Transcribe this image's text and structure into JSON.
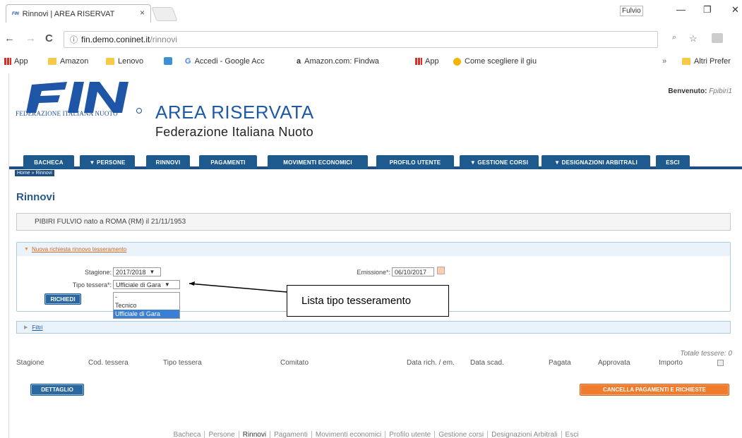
{
  "browser": {
    "tab_title": "Rinnovi | AREA RISERVAT",
    "tab_favicon_text": "FIN",
    "tab_close": "×",
    "window_user": "Fulvio",
    "win_min": "—",
    "win_max": "❐",
    "win_close": "✕",
    "back_icon": "←",
    "forward_icon": "→",
    "reload_icon": "C",
    "url_info_icon": "ⓘ",
    "url_host": "fin.demo.coninet.it",
    "url_path": "/rinnovi",
    "zoom_icon": "🔍",
    "star_icon": "☆",
    "bookmarks": [
      {
        "label": "App",
        "kind": "apps"
      },
      {
        "label": "Amazon",
        "kind": "folder"
      },
      {
        "label": "Lenovo",
        "kind": "folder"
      },
      {
        "label": "",
        "kind": "bing"
      },
      {
        "label": "Accedi - Google Acc",
        "kind": "google"
      },
      {
        "label": "Amazon.com: Findwa",
        "kind": "amazon"
      },
      {
        "label": "App",
        "kind": "apps"
      },
      {
        "label": "Come scegliere il giu",
        "kind": "tip"
      }
    ],
    "bookmarks_more": "»",
    "other_bookmarks": "Altri Prefer"
  },
  "header": {
    "logo_text": "FIN",
    "logo_sub": "FEDERAZIONE ITALIANA NUOTO",
    "title": "AREA RISERVATA",
    "subtitle": "Federazione Italiana Nuoto",
    "welcome_label": "Benvenuto:",
    "welcome_user": "Fpibiri1"
  },
  "menu": [
    {
      "label": "BACHECA"
    },
    {
      "label": "▼ PERSONE"
    },
    {
      "label": "RINNOVI"
    },
    {
      "label": "PAGAMENTI"
    },
    {
      "label": "MOVIMENTI ECONOMICI"
    },
    {
      "label": "PROFILO UTENTE"
    },
    {
      "label": "▼ GESTIONE CORSI"
    },
    {
      "label": "▼ DESIGNAZIONI ARBITRALI"
    },
    {
      "label": "ESCI"
    }
  ],
  "breadcrumb": "Home » Rinnovi",
  "page_title": "Rinnovi",
  "person_info": "PIBIRI FULVIO nato a ROMA (RM) il 21/11/1953",
  "panel": {
    "title": "Nuova richiesta rinnovo tesseramento",
    "stagione_label": "Stagione:",
    "stagione_value": "2017/2018",
    "tipo_label": "Tipo tessera*:",
    "tipo_value": "Ufficiale di Gara",
    "tipo_options": [
      "-",
      "Tecnico",
      "Ufficiale di Gara"
    ],
    "emissione_label": "Emissione*:",
    "emissione_value": "06/10/2017",
    "richiedi_label": "RICHIEDI"
  },
  "filtri_label": "Filtri",
  "totale_label": "Totale tessere: 0",
  "columns": [
    "Stagione",
    "Cod. tessera",
    "Tipo tessera",
    "Comitato",
    "Data rich. / em.",
    "Data scad.",
    "Pagata",
    "Approvata",
    "Importo"
  ],
  "dettaglio_label": "DETTAGLIO",
  "cancella_label": "CANCELLA PAGAMENTI E RICHIESTE",
  "footer": [
    "Bacheca",
    "Persone",
    "Rinnovi",
    "Pagamenti",
    "Movimenti economici",
    "Profilo utente",
    "Gestione corsi",
    "Designazioni Arbitrali",
    "Esci"
  ],
  "callout": "Lista tipo tesseramento",
  "colors": {
    "menu_bg": "#1e5a8e",
    "accent_orange": "#f07b2c",
    "title_blue": "#1e5aa8"
  }
}
